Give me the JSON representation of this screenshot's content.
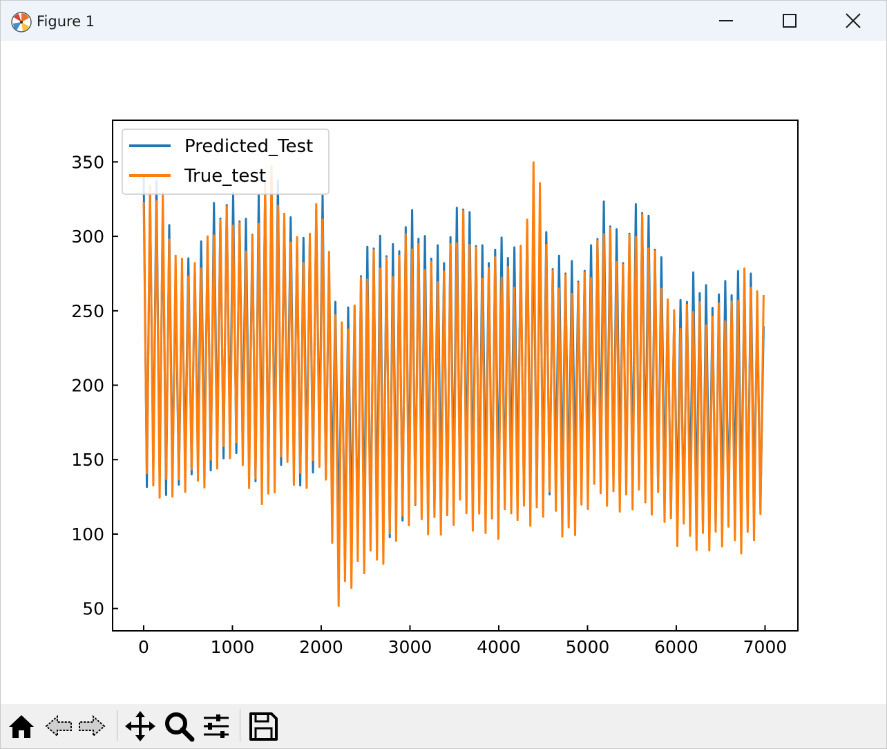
{
  "window": {
    "title": "Figure 1"
  },
  "toolbar": {
    "buttons": [
      "home-icon",
      "back-icon",
      "forward-icon",
      "pan-icon",
      "zoom-icon",
      "configure-icon",
      "save-icon"
    ]
  },
  "chart_data": {
    "type": "line",
    "xlim": [
      -350,
      7370
    ],
    "ylim": [
      35,
      378
    ],
    "xticks": [
      0,
      1000,
      2000,
      3000,
      4000,
      5000,
      6000,
      7000
    ],
    "yticks": [
      50,
      100,
      150,
      200,
      250,
      300,
      350
    ],
    "legend_position": "upper-left",
    "grid": false,
    "series": [
      {
        "name": "Predicted_Test",
        "color": "#1f77b4",
        "x": [
          0,
          200,
          400,
          600,
          800,
          1000,
          1200,
          1400,
          1600,
          1800,
          2000,
          2200,
          2400,
          2600,
          2800,
          3000,
          3200,
          3400,
          3600,
          3800,
          4000,
          4200,
          4400,
          4600,
          4800,
          5000,
          5200,
          5400,
          5600,
          5800,
          6000,
          6200,
          6400,
          6600,
          6800,
          7000
        ],
        "peaks": [
          340,
          340,
          280,
          290,
          330,
          330,
          310,
          360,
          320,
          305,
          335,
          240,
          275,
          305,
          300,
          320,
          300,
          300,
          330,
          300,
          300,
          295,
          330,
          290,
          290,
          285,
          330,
          300,
          330,
          300,
          250,
          280,
          270,
          270,
          290,
          245
        ],
        "troughs": [
          125,
          125,
          130,
          135,
          145,
          150,
          140,
          125,
          145,
          130,
          145,
          90,
          90,
          85,
          100,
          110,
          120,
          110,
          120,
          120,
          115,
          125,
          120,
          120,
          130,
          130,
          140,
          130,
          125,
          130,
          100,
          110,
          100,
          110,
          110,
          115
        ]
      },
      {
        "name": "True_test",
        "color": "#ff7f0e",
        "x": [
          0,
          200,
          400,
          600,
          800,
          1000,
          1200,
          1400,
          1600,
          1800,
          2000,
          2200,
          2400,
          2600,
          2800,
          3000,
          3200,
          3400,
          3600,
          3800,
          4000,
          4200,
          4400,
          4600,
          4800,
          5000,
          5200,
          5400,
          5600,
          5800,
          6000,
          6200,
          6400,
          6600,
          6800,
          7000
        ],
        "peaks": [
          335,
          340,
          285,
          285,
          320,
          320,
          300,
          355,
          315,
          300,
          330,
          245,
          265,
          295,
          290,
          305,
          290,
          285,
          320,
          290,
          285,
          280,
          362,
          280,
          280,
          275,
          320,
          290,
          320,
          290,
          245,
          265,
          255,
          255,
          290,
          258
        ],
        "troughs": [
          120,
          125,
          120,
          125,
          140,
          145,
          130,
          110,
          140,
          125,
          140,
          50,
          65,
          70,
          90,
          100,
          100,
          95,
          105,
          100,
          90,
          110,
          100,
          110,
          90,
          110,
          120,
          110,
          110,
          115,
          85,
          90,
          85,
          85,
          88,
          100
        ]
      }
    ]
  }
}
